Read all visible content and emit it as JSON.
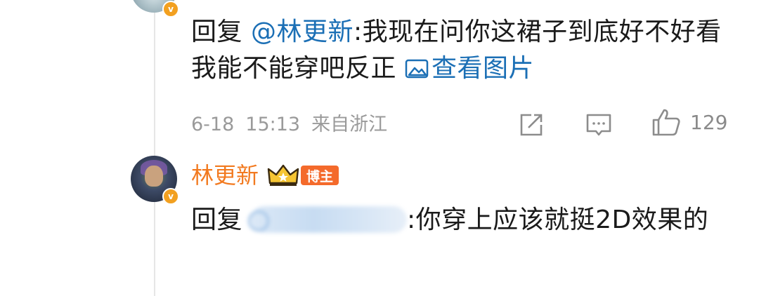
{
  "comment_1": {
    "reply_prefix": "回复",
    "mention": "@林更新",
    "text": ":我现在问你这裙子到底好不好看 我能不能穿吧反正",
    "view_image_label": "查看图片",
    "date": "6-18",
    "time": "15:13",
    "location": "来自浙江",
    "like_count": "129"
  },
  "comment_2": {
    "username": "林更新",
    "badge_label": "博主",
    "reply_prefix": "回复",
    "text": ":你穿上应该就挺2D效果的"
  },
  "icons": {
    "share": "share-icon",
    "comment": "comment-icon",
    "like": "thumbs-up-icon",
    "verified": "verified-v-icon",
    "crown": "crown-icon",
    "image": "image-icon"
  },
  "colors": {
    "mention": "#1b6fb5",
    "username": "#f27a20",
    "badge": "#f46a2b",
    "meta": "#9a9a9a"
  }
}
